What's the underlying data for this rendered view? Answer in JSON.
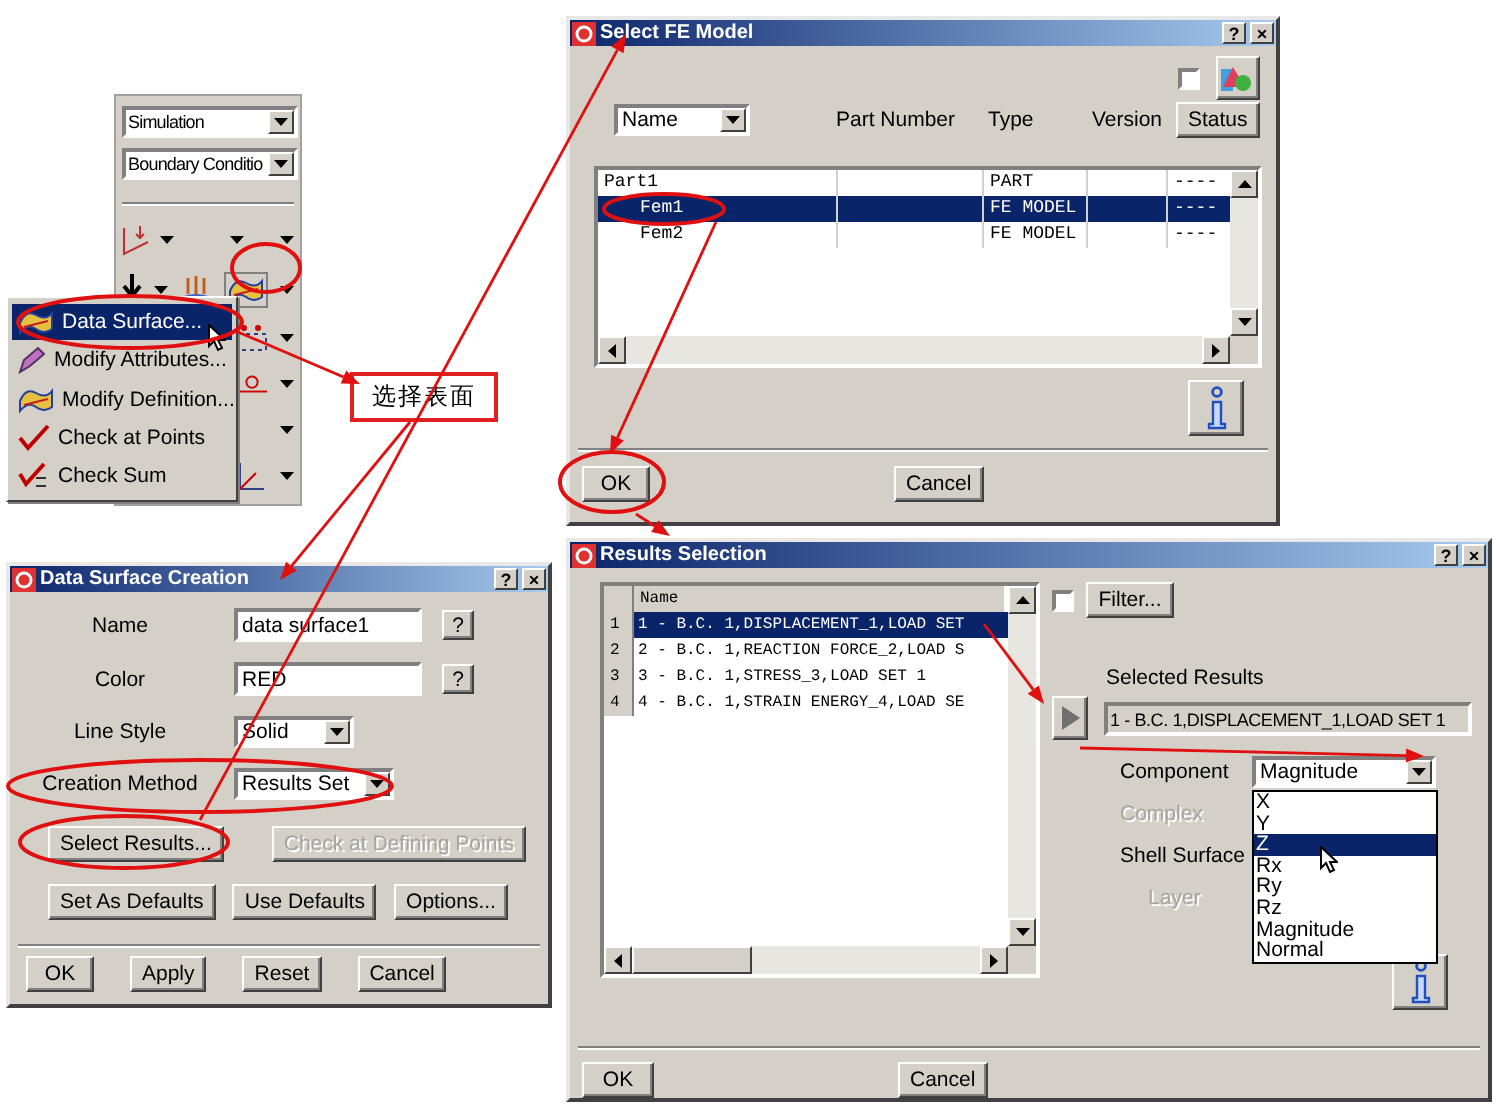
{
  "toolbar": {
    "dropdowns": [
      {
        "value": "Simulation"
      },
      {
        "value": "Boundary Conditio"
      }
    ]
  },
  "popup_menu": {
    "items": [
      {
        "label": "Data Surface...",
        "selected": true
      },
      {
        "label": "Modify Attributes...",
        "selected": false
      },
      {
        "label": "Modify Definition...",
        "selected": false
      },
      {
        "label": "Check at Points",
        "selected": false
      },
      {
        "label": "Check Sum",
        "selected": false
      }
    ]
  },
  "callout": {
    "text": "选择表面"
  },
  "data_surface_dialog": {
    "title": "Data Surface Creation",
    "title_buttons": [
      "?",
      "×"
    ],
    "fields": [
      {
        "label": "Name",
        "kind": "text",
        "value": "data surface1",
        "help_button": "?"
      },
      {
        "label": "Color",
        "kind": "text",
        "value": "RED",
        "help_button": "?"
      },
      {
        "label": "Line Style",
        "kind": "select",
        "value": "Solid"
      },
      {
        "label": "Creation Method",
        "kind": "select",
        "value": "Results Set"
      }
    ],
    "action_buttons": [
      {
        "label": "Select Results...",
        "disabled": false
      },
      {
        "label": "Check at Defining Points",
        "disabled": true
      }
    ],
    "default_buttons": [
      "Set As Defaults",
      "Use Defaults",
      "Options..."
    ],
    "footer_buttons": [
      "OK",
      "Apply",
      "Reset",
      "Cancel"
    ]
  },
  "select_fe_model": {
    "title": "Select FE Model",
    "title_buttons": [
      "?",
      "×"
    ],
    "checkbox_checked": false,
    "sort_select": "Name",
    "column_headers": [
      "Part Number",
      "Type",
      "Version"
    ],
    "status_button": "Status",
    "rows": [
      {
        "name": "Part1",
        "type": "PART",
        "column_5": "----",
        "selected": false,
        "children": [
          {
            "name": "Fem1",
            "type": "FE MODEL",
            "column_5": "----",
            "selected": true
          },
          {
            "name": "Fem2",
            "type": "FE MODEL",
            "column_5": "----",
            "selected": false
          }
        ]
      }
    ],
    "footer_buttons": [
      "OK",
      "Cancel"
    ]
  },
  "results_selection": {
    "title": "Results Selection",
    "title_buttons": [
      "?",
      "×"
    ],
    "column_header": "Name",
    "rows": [
      {
        "index": "1",
        "name": "1 -  B.C. 1,DISPLACEMENT_1,LOAD SET",
        "selected": true
      },
      {
        "index": "2",
        "name": "2 -  B.C. 1,REACTION FORCE_2,LOAD S",
        "selected": false
      },
      {
        "index": "3",
        "name": "3 -  B.C. 1,STRESS_3,LOAD SET 1",
        "selected": false
      },
      {
        "index": "4",
        "name": "4 -  B.C. 1,STRAIN ENERGY_4,LOAD SE",
        "selected": false
      }
    ],
    "filter_checked": false,
    "filter_button": "Filter...",
    "selected_results_label": "Selected Results",
    "selected_results_value": "1 - B.C. 1,DISPLACEMENT_1,LOAD SET 1",
    "options": [
      {
        "label": "Component",
        "disabled": false,
        "value": "Magnitude"
      },
      {
        "label": "Complex",
        "disabled": true
      },
      {
        "label": "Shell Surface",
        "disabled": false
      },
      {
        "label": "Layer",
        "disabled": true
      }
    ],
    "component_list": [
      {
        "label": "X",
        "selected": false
      },
      {
        "label": "Y",
        "selected": false
      },
      {
        "label": "Z",
        "selected": true
      },
      {
        "label": "Rx",
        "selected": false
      },
      {
        "label": "Ry",
        "selected": false
      },
      {
        "label": "Rz",
        "selected": false
      },
      {
        "label": "Magnitude",
        "selected": false
      },
      {
        "label": "Normal",
        "selected": false
      }
    ],
    "footer_buttons": [
      "OK",
      "Cancel"
    ]
  }
}
